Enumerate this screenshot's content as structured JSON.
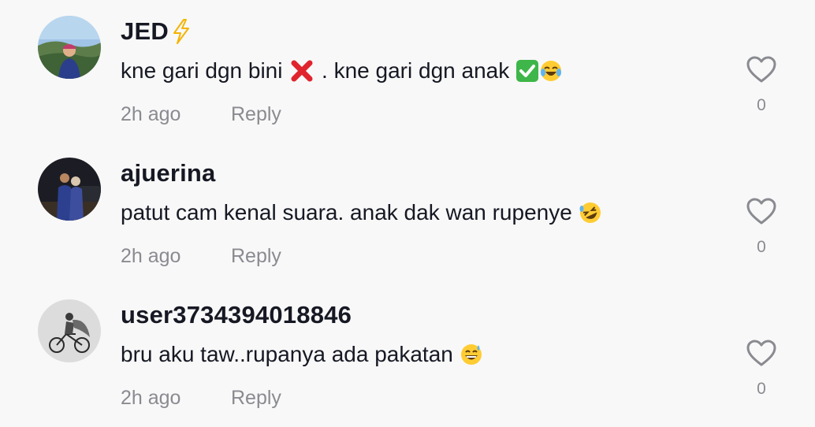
{
  "comments": [
    {
      "username": "JED",
      "text_part1": "kne gari dgn bini ",
      "text_part2": " . kne gari dgn anak ",
      "time": "2h ago",
      "reply_label": "Reply",
      "likes": "0",
      "avatar_icon": "avatar-man-outdoors",
      "username_icon": "lightning-bolt-icon",
      "emojis": [
        "cross-mark-emoji",
        "check-mark-emoji",
        "tears-of-joy-emoji"
      ]
    },
    {
      "username": "ajuerina",
      "text": "patut cam kenal suara. anak dak wan rupenye ",
      "time": "2h ago",
      "reply_label": "Reply",
      "likes": "0",
      "avatar_icon": "avatar-couple-night",
      "emojis": [
        "rolling-laughing-emoji"
      ]
    },
    {
      "username": "user3734394018846",
      "text": "bru aku taw..rupanya ada pakatan ",
      "time": "2h ago",
      "reply_label": "Reply",
      "likes": "0",
      "avatar_icon": "avatar-cyclist-sketch",
      "emojis": [
        "grinning-sweat-emoji"
      ]
    }
  ],
  "colors": {
    "background": "#f8f8f8",
    "text": "#161823",
    "muted": "#8a8b91"
  }
}
